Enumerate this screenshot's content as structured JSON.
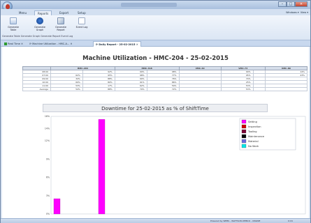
{
  "window": {
    "title": ""
  },
  "menubar": {
    "tabs": [
      "Menu",
      "Reports",
      "Export",
      "Setup"
    ],
    "active_tab": "Reports",
    "right_links": [
      "Windows",
      "View"
    ]
  },
  "ribbon": {
    "buttons": [
      {
        "label": "Generate Table",
        "icon": "table-icon"
      },
      {
        "label": "Generate Graph",
        "icon": "graph-icon"
      },
      {
        "label": "Generate Report",
        "icon": "report-icon"
      },
      {
        "label": "Event Log",
        "icon": "event-log-icon"
      }
    ],
    "group_labels": "Generate Table  Generate Graph  Generate Report  Event Log"
  },
  "doc_tabs": [
    {
      "label": "Real Time"
    },
    {
      "label": "Machine Utilization - HMC-A..."
    },
    {
      "label": "Daily Report - 25-02-2015"
    }
  ],
  "report": {
    "title": "Machine Utilization - HMC-204 - 25-02-2015",
    "table": {
      "columns": [
        "",
        "HMC-204",
        "HMC-318",
        "VMC-40",
        "VMC-73",
        "VMC-80"
      ],
      "rows": [
        [
          "08:00",
          "",
          "92%",
          "99%",
          "98%",
          "",
          "99%",
          "",
          "14%"
        ],
        [
          "07:00",
          "62%",
          "95%",
          "98%",
          "77%",
          "",
          "95%",
          "",
          "23%"
        ],
        [
          "09:00",
          "34%",
          "88%",
          "90%",
          "76%",
          "",
          "74%",
          "",
          ""
        ],
        [
          "10:00",
          "69%",
          "80%",
          "91%",
          "86%",
          "",
          "25%",
          "",
          ""
        ],
        [
          "11:00",
          "53%",
          "17%",
          "62%",
          "50%",
          "",
          "53%",
          "",
          ""
        ],
        [
          "Average",
          "54%",
          "88%",
          "70%",
          "72%",
          "",
          "53%",
          "",
          ""
        ]
      ]
    }
  },
  "chart": {
    "title": "Downtime for 25-02-2015 as % of ShiftTime"
  },
  "chart_data": {
    "type": "bar",
    "title": "Downtime for 25-02-2015 as % of ShiftTime",
    "xlabel": "",
    "ylabel": "",
    "ylim": [
      0,
      16
    ],
    "yticks": [
      "0%",
      "3%",
      "6%",
      "9%",
      "12%",
      "14%",
      "16%"
    ],
    "yticks_values": [
      0,
      3,
      6,
      9,
      12,
      14,
      16
    ],
    "series": [
      {
        "name": "Setting",
        "color": "#ff00ff",
        "values": [
          2.5,
          0,
          15.5
        ]
      }
    ],
    "categories": [
      "",
      "",
      ""
    ],
    "legend": {
      "position": "top-right",
      "entries": [
        {
          "name": "Setting",
          "color": "#ff00ff"
        },
        {
          "name": "Inspection",
          "color": "#cc0000"
        },
        {
          "name": "Tooling",
          "color": "#7a0033"
        },
        {
          "name": "Maintenance",
          "color": "#000000"
        },
        {
          "name": "Material",
          "color": "#6a6adf"
        },
        {
          "name": "No Work",
          "color": "#00e5e5"
        }
      ]
    },
    "grid": false
  },
  "status": {
    "left": "Powered by WEBS - WATTSON WEBCO - ONLINE",
    "right": "0:16"
  }
}
